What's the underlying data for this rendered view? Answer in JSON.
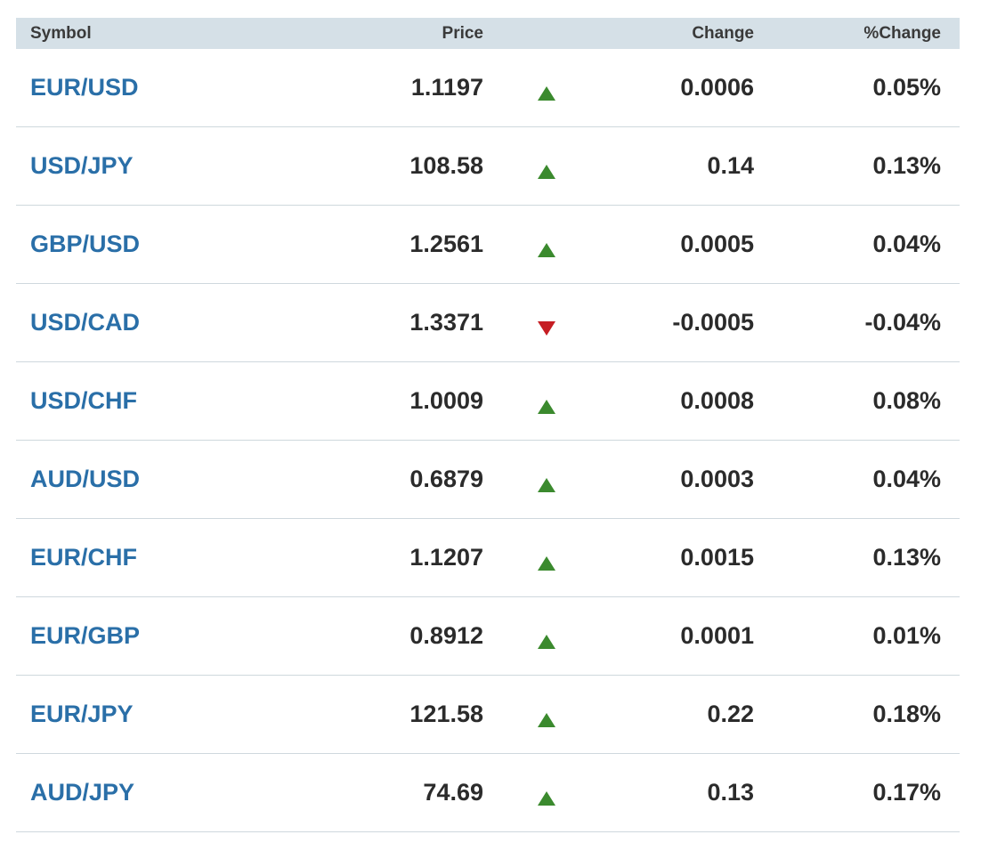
{
  "header": {
    "symbol": "Symbol",
    "price": "Price",
    "change": "Change",
    "pct_change": "%Change"
  },
  "colors": {
    "up": "#3b8a2e",
    "down": "#c61d23",
    "symbol_link": "#2a6fa8",
    "header_bg": "#d5e0e7"
  },
  "rows": [
    {
      "symbol": "EUR/USD",
      "price": "1.1197",
      "direction": "up",
      "change": "0.0006",
      "pct": "0.05%"
    },
    {
      "symbol": "USD/JPY",
      "price": "108.58",
      "direction": "up",
      "change": "0.14",
      "pct": "0.13%"
    },
    {
      "symbol": "GBP/USD",
      "price": "1.2561",
      "direction": "up",
      "change": "0.0005",
      "pct": "0.04%"
    },
    {
      "symbol": "USD/CAD",
      "price": "1.3371",
      "direction": "down",
      "change": "-0.0005",
      "pct": "-0.04%"
    },
    {
      "symbol": "USD/CHF",
      "price": "1.0009",
      "direction": "up",
      "change": "0.0008",
      "pct": "0.08%"
    },
    {
      "symbol": "AUD/USD",
      "price": "0.6879",
      "direction": "up",
      "change": "0.0003",
      "pct": "0.04%"
    },
    {
      "symbol": "EUR/CHF",
      "price": "1.1207",
      "direction": "up",
      "change": "0.0015",
      "pct": "0.13%"
    },
    {
      "symbol": "EUR/GBP",
      "price": "0.8912",
      "direction": "up",
      "change": "0.0001",
      "pct": "0.01%"
    },
    {
      "symbol": "EUR/JPY",
      "price": "121.58",
      "direction": "up",
      "change": "0.22",
      "pct": "0.18%"
    },
    {
      "symbol": "AUD/JPY",
      "price": "74.69",
      "direction": "up",
      "change": "0.13",
      "pct": "0.17%"
    }
  ]
}
